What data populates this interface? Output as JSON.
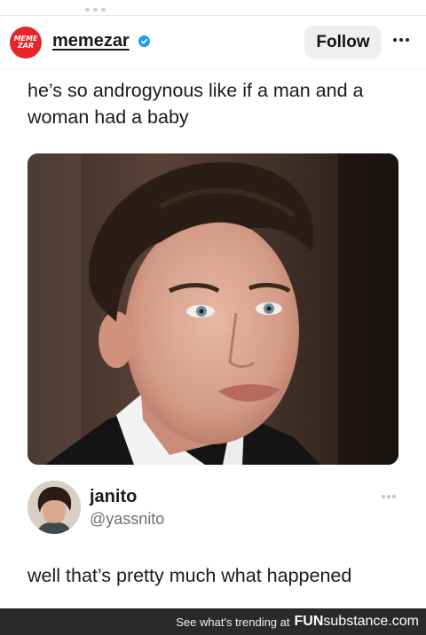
{
  "account": {
    "logo_line1": "MEME",
    "logo_line2": "ZAR",
    "username": "memezar",
    "follow_label": "Follow"
  },
  "post": {
    "text": "he’s so androgynous like if a man and a woman had a baby"
  },
  "reply": {
    "name": "janito",
    "handle": "@yassnito",
    "text": "well that’s pretty much what happened"
  },
  "footer": {
    "tagline": "See what's trending at",
    "brand_bold": "FUN",
    "brand_rest": "substance.com"
  },
  "colors": {
    "brand_red": "#e8232a",
    "verified_blue": "#1d9bf0",
    "footer_bg": "#2a2a2a"
  },
  "icons": [
    "verified-badge-icon",
    "more-options-icon",
    "reply-more-icon"
  ]
}
